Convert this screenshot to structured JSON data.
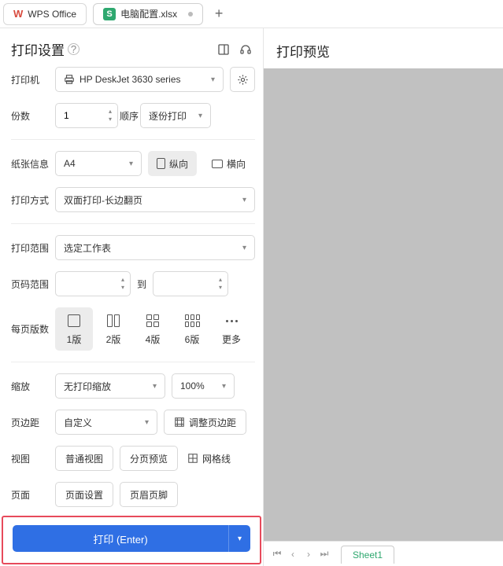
{
  "tabbar": {
    "app_tab": "WPS Office",
    "file_tab": "电脑配置.xlsx"
  },
  "panel": {
    "title": "打印设置"
  },
  "printer": {
    "label": "打印机",
    "selected": "HP DeskJet 3630 series"
  },
  "copies": {
    "label": "份数",
    "value": "1",
    "order_label": "顺序",
    "order_value": "逐份打印"
  },
  "paper": {
    "label": "纸张信息",
    "size": "A4",
    "portrait": "纵向",
    "landscape": "横向"
  },
  "duplex": {
    "label": "打印方式",
    "value": "双面打印-长边翻页"
  },
  "range": {
    "label": "打印范围",
    "value": "选定工作表"
  },
  "page_range": {
    "label": "页码范围",
    "to": "到"
  },
  "layout": {
    "label": "每页版数",
    "v1": "1版",
    "v2": "2版",
    "v4": "4版",
    "v6": "6版",
    "more": "更多"
  },
  "scale": {
    "label": "缩放",
    "mode": "无打印缩放",
    "percent": "100%"
  },
  "margins": {
    "label": "页边距",
    "value": "自定义",
    "adjust": "调整页边距"
  },
  "view": {
    "label": "视图",
    "normal": "普通视图",
    "pagebreak": "分页预览",
    "gridlines": "网格线"
  },
  "page": {
    "label": "页面",
    "setup": "页面设置",
    "header_footer": "页眉页脚"
  },
  "print_btn": "打印 (Enter)",
  "preview": {
    "title": "打印预览",
    "sheet": "Sheet1"
  }
}
